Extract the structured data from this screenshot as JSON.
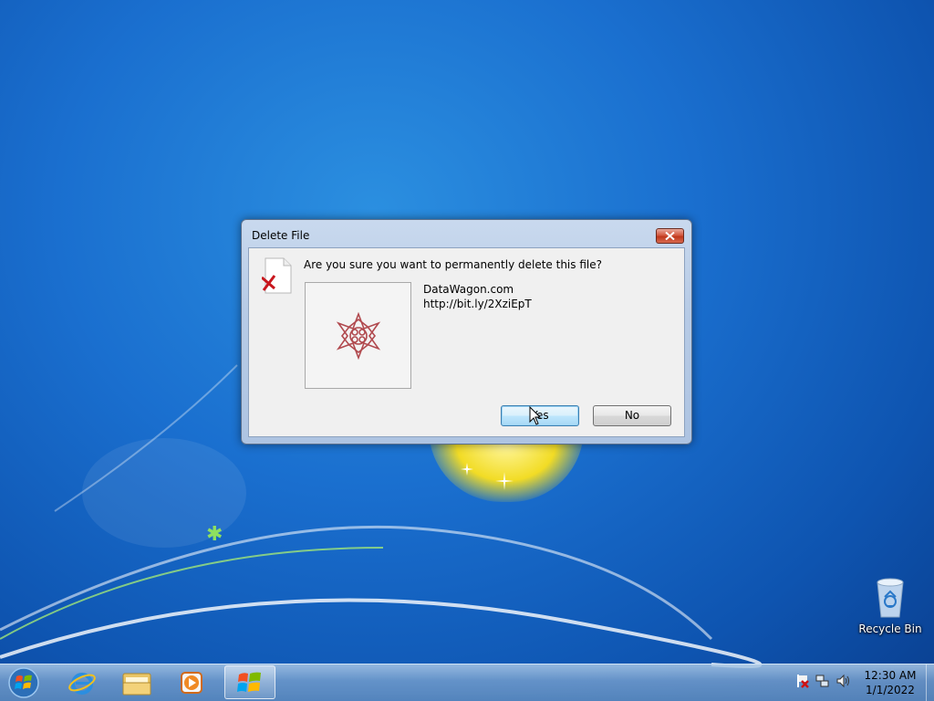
{
  "dialog": {
    "title": "Delete File",
    "message": "Are you sure you want to permanently delete this file?",
    "file_name": "DataWagon.com",
    "file_detail": "http://bit.ly/2XziEpT",
    "yes_label": "Yes",
    "no_label": "No"
  },
  "desktop": {
    "icons": [
      {
        "label": "Recycle Bin",
        "icon": "recycle-bin-icon"
      }
    ]
  },
  "taskbar": {
    "start_icon": "windows-start-icon",
    "pinned": [
      {
        "name": "internet-explorer",
        "icon": "internet-explorer-icon"
      },
      {
        "name": "windows-explorer",
        "icon": "folder-icon"
      },
      {
        "name": "media-player",
        "icon": "media-player-icon"
      },
      {
        "name": "active-window",
        "icon": "windows-flag-icon"
      }
    ],
    "tray_icons": [
      "action-center-icon",
      "network-icon",
      "volume-icon"
    ],
    "clock_time": "12:30 AM",
    "clock_date": "1/1/2022"
  }
}
